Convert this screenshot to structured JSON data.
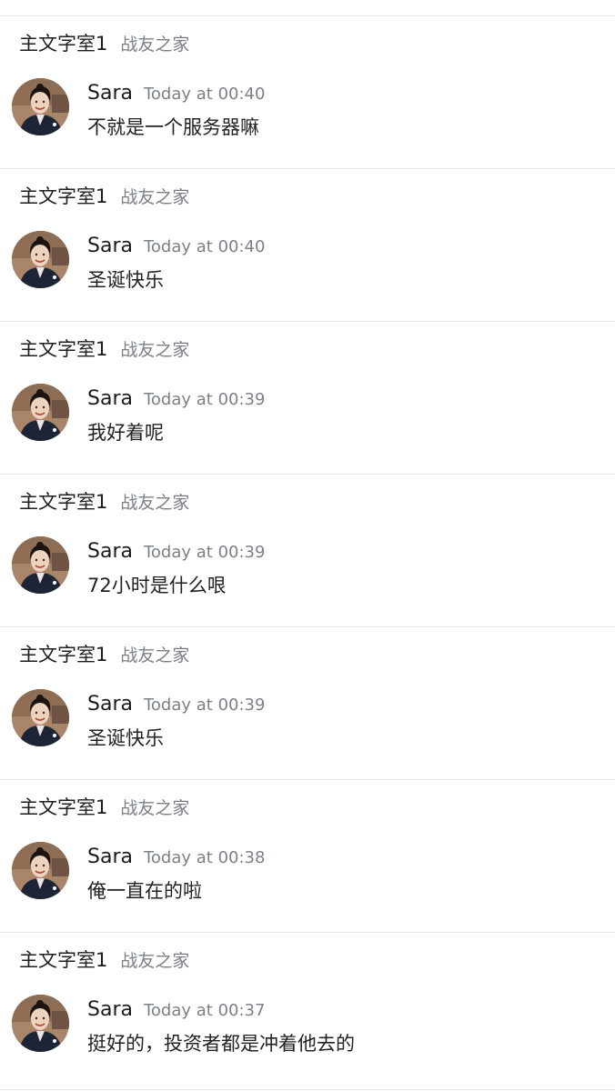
{
  "messages": [
    {
      "channel": "主文字室1",
      "server": "战友之家",
      "author": "Sara",
      "time": "Today at 00:40",
      "text": "不就是一个服务器嘛"
    },
    {
      "channel": "主文字室1",
      "server": "战友之家",
      "author": "Sara",
      "time": "Today at 00:40",
      "text": "圣诞快乐"
    },
    {
      "channel": "主文字室1",
      "server": "战友之家",
      "author": "Sara",
      "time": "Today at 00:39",
      "text": "我好着呢"
    },
    {
      "channel": "主文字室1",
      "server": "战友之家",
      "author": "Sara",
      "time": "Today at 00:39",
      "text": "72小时是什么哏"
    },
    {
      "channel": "主文字室1",
      "server": "战友之家",
      "author": "Sara",
      "time": "Today at 00:39",
      "text": "圣诞快乐"
    },
    {
      "channel": "主文字室1",
      "server": "战友之家",
      "author": "Sara",
      "time": "Today at 00:38",
      "text": "俺一直在的啦"
    },
    {
      "channel": "主文字室1",
      "server": "战友之家",
      "author": "Sara",
      "time": "Today at 00:37",
      "text": "挺好的，投资者都是冲着他去的"
    }
  ],
  "colors": {
    "background": "#ffffff",
    "divider": "#e6e7ea",
    "muted_text": "#7b8089"
  }
}
